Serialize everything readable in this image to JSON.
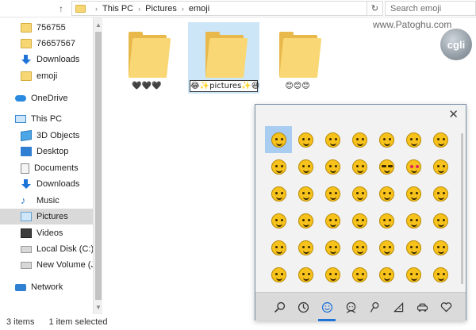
{
  "address": {
    "crumbs": [
      "This PC",
      "Pictures",
      "emoji"
    ]
  },
  "search": {
    "placeholder": "Search emoji"
  },
  "watermark": {
    "text": "www.Patoghu.com",
    "logo": "cgli"
  },
  "sidebar": {
    "items": [
      {
        "label": "756755",
        "icon": "folder"
      },
      {
        "label": "76657567",
        "icon": "folder"
      },
      {
        "label": "Downloads",
        "icon": "download"
      },
      {
        "label": "emoji",
        "icon": "folder"
      },
      {
        "label": "OneDrive",
        "icon": "cloud"
      },
      {
        "label": "This PC",
        "icon": "pc"
      },
      {
        "label": "3D Objects",
        "icon": "cube"
      },
      {
        "label": "Desktop",
        "icon": "desktop"
      },
      {
        "label": "Documents",
        "icon": "docs"
      },
      {
        "label": "Downloads",
        "icon": "download"
      },
      {
        "label": "Music",
        "icon": "music"
      },
      {
        "label": "Pictures",
        "icon": "pictures"
      },
      {
        "label": "Videos",
        "icon": "videos"
      },
      {
        "label": "Local Disk (C:)",
        "icon": "disk"
      },
      {
        "label": "New Volume (J:)",
        "icon": "disk"
      },
      {
        "label": "Network",
        "icon": "network"
      }
    ]
  },
  "folders": [
    {
      "name": "🖤🖤🖤"
    },
    {
      "name": "😂✨pictures✨😆"
    },
    {
      "name": "😊😊😊"
    }
  ],
  "status": {
    "count": "3 items",
    "selected": "1 item selected"
  },
  "emoji_panel": {
    "close": "✕",
    "tabs": [
      "search-icon",
      "recent-icon",
      "smiley-icon",
      "people-icon",
      "celebration-icon",
      "food-icon",
      "travel-icon",
      "heart-icon"
    ],
    "active_tab": 2
  },
  "colors": {
    "selection": "#cde6f7",
    "emoji_select": "#a9ccf1",
    "accent": "#1e73d8"
  }
}
